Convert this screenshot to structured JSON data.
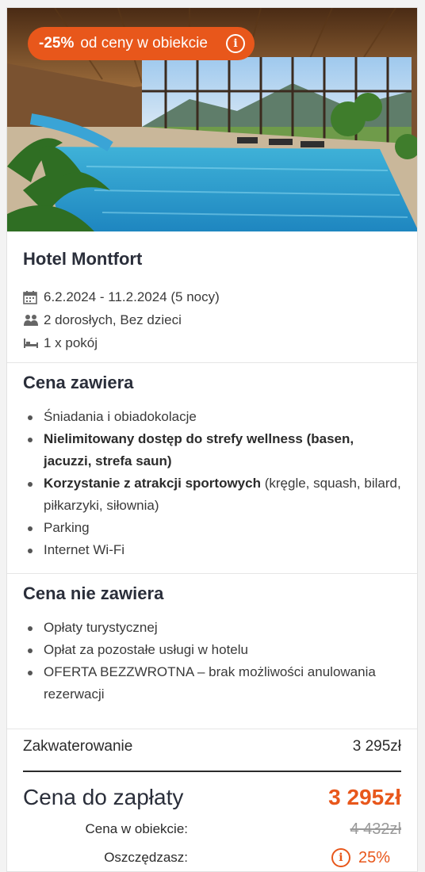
{
  "badge": {
    "percent": "-25%",
    "text": "od ceny w obiekcie"
  },
  "hotel": {
    "name": "Hotel Montfort",
    "dates": "6.2.2024 - 11.2.2024 (5 nocy)",
    "guests": "2 dorosłych,  Bez dzieci",
    "rooms": "1 x pokój"
  },
  "includes": {
    "title": "Cena zawiera",
    "items": [
      {
        "bold": "",
        "text": "Śniadania i obiadokolacje"
      },
      {
        "bold": "Nielimitowany dostęp do strefy wellness (basen, jacuzzi, strefa saun)",
        "text": ""
      },
      {
        "bold": "Korzystanie z atrakcji sportowych",
        "text": " (kręgle, squash, bilard, piłkarzyki, siłownia)"
      },
      {
        "bold": "",
        "text": "Parking"
      },
      {
        "bold": "",
        "text": "Internet Wi-Fi"
      }
    ]
  },
  "excludes": {
    "title": "Cena nie zawiera",
    "items": [
      "Opłaty turystycznej",
      "Opłat za pozostałe usługi w hotelu",
      "OFERTA BEZZWROTNA – brak możliwości anulowania rezerwacji"
    ]
  },
  "price": {
    "accommodation_label": "Zakwaterowanie",
    "accommodation_value": "3 295zł",
    "total_label": "Cena do zapłaty",
    "total_value": "3 295zł",
    "original_label": "Cena w obiekcie:",
    "original_value": "4 432zł",
    "savings_label": "Oszczędzasz:",
    "savings_value": "25%"
  },
  "colors": {
    "accent": "#e8571b",
    "heading": "#2a2e3a"
  }
}
